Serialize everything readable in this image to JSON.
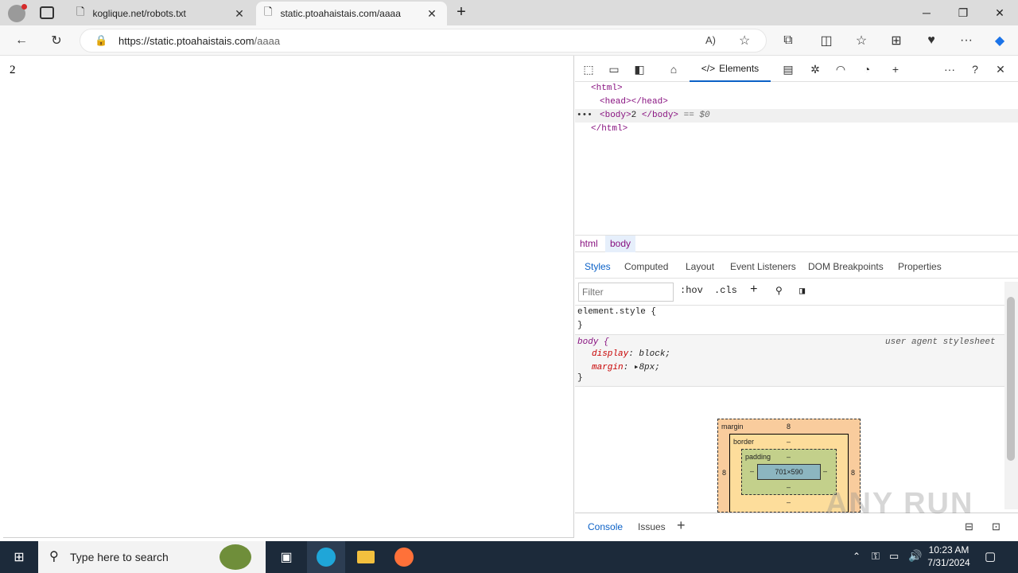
{
  "tabs": [
    {
      "title": "koglique.net/robots.txt",
      "active": false
    },
    {
      "title": "static.ptoahaistais.com/aaaa",
      "active": true
    }
  ],
  "window_controls": {
    "minimize": "─",
    "maximize": "❐",
    "close": "✕"
  },
  "address": {
    "url_domain": "https://static.ptoahaistais.com",
    "url_path": "/aaaa"
  },
  "page": {
    "body_text": "2"
  },
  "devtools": {
    "active_tab": "Elements",
    "dom_lines": [
      {
        "open": "<html>",
        "text": "",
        "close": "",
        "extra": ""
      },
      {
        "open": "<head>",
        "text": "",
        "close": "</head>",
        "extra": ""
      },
      {
        "open": "<body>",
        "text": "2 ",
        "close": "</body>",
        "extra": " == $0"
      },
      {
        "open": "</html>",
        "text": "",
        "close": "",
        "extra": ""
      }
    ],
    "breadcrumbs": [
      "html",
      "body"
    ],
    "subtabs": [
      "Styles",
      "Computed",
      "Layout",
      "Event Listeners",
      "DOM Breakpoints",
      "Properties"
    ],
    "filter_placeholder": "Filter",
    "filter_buttons": {
      "hov": ":hov",
      "cls": ".cls"
    },
    "rules": {
      "element_style_open": "element.style {",
      "element_style_close": "}",
      "body_selector": "body {",
      "body_source": "user agent stylesheet",
      "display_prop": "display",
      "display_val": "block;",
      "margin_prop": "margin",
      "margin_val": "8px;",
      "close": "}"
    },
    "box_model": {
      "margin_label": "margin",
      "margin_top": "8",
      "margin_left": "8",
      "margin_right": "8",
      "border_label": "border",
      "border_top": "–",
      "padding_label": "padding",
      "padding_top": "–",
      "padding_left": "–",
      "padding_right": "–",
      "padding_bottom": "–",
      "border_bottom": "–",
      "content": "701×590"
    },
    "drawer_tabs": [
      "Console",
      "Issues"
    ]
  },
  "taskbar": {
    "search_placeholder": "Type here to search",
    "time": "10:23 AM",
    "date": "7/31/2024"
  },
  "watermark": "ANY RUN"
}
